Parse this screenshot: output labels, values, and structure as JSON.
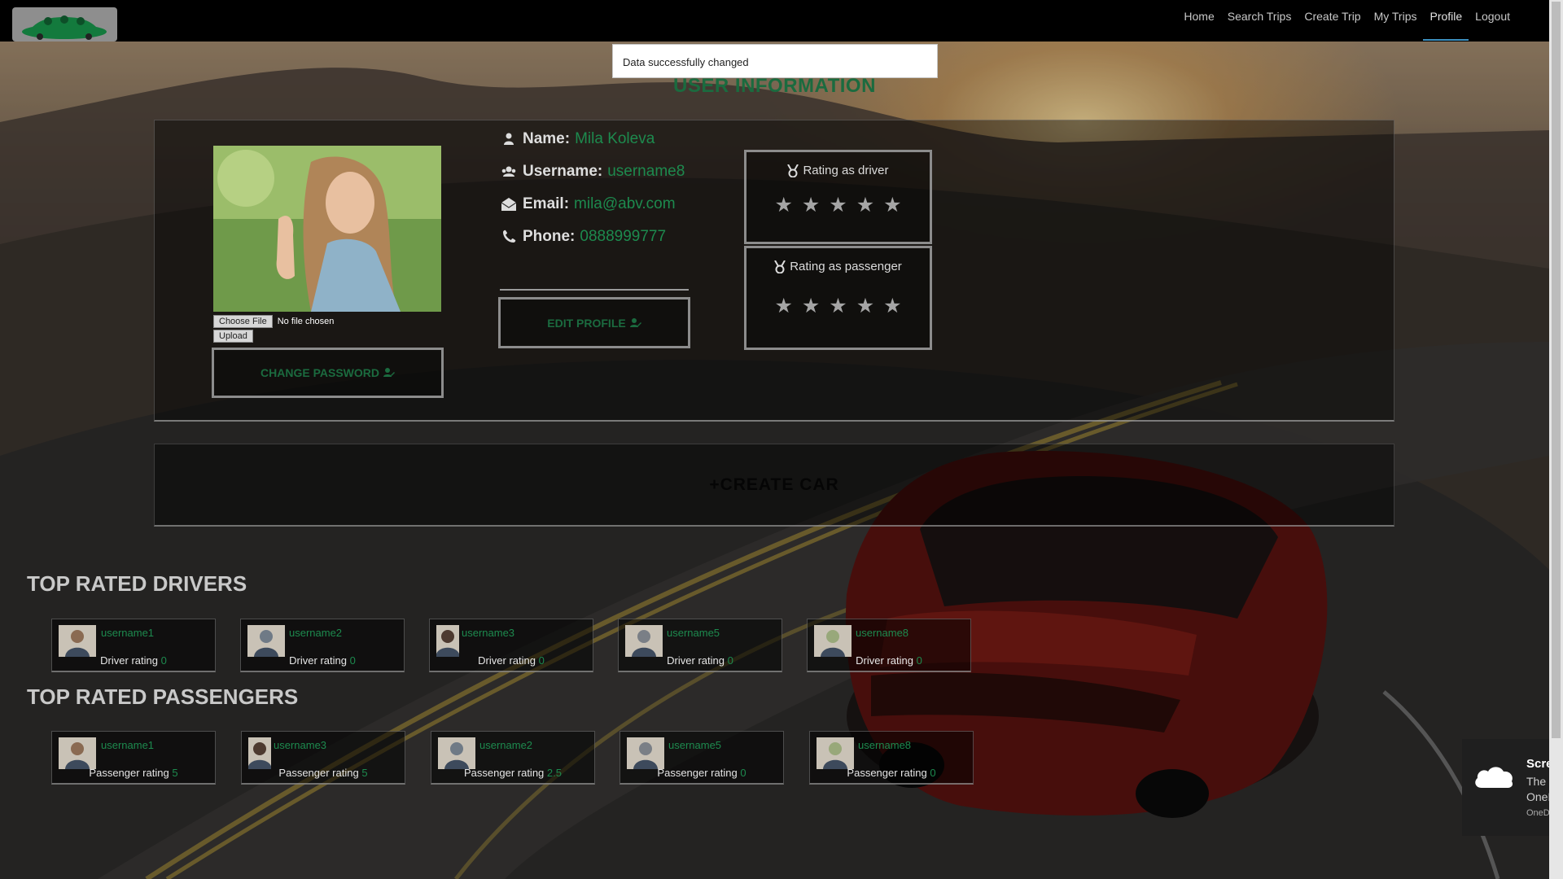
{
  "nav": {
    "items": [
      {
        "label": "Home"
      },
      {
        "label": "Search Trips"
      },
      {
        "label": "Create Trip"
      },
      {
        "label": "My Trips"
      },
      {
        "label": "Profile",
        "active": true
      },
      {
        "label": "Logout"
      }
    ]
  },
  "alert": {
    "text": "Data successfully changed"
  },
  "page_title": "USER INFORMATION",
  "profile": {
    "file_button": "Choose File",
    "file_status": "No file chosen",
    "upload_button": "Upload",
    "change_password": "CHANGE PASSWORD",
    "edit_profile": "EDIT PROFILE",
    "name_label": "Name:",
    "name": "Mila Koleva",
    "username_label": "Username:",
    "username": "username8",
    "email_label": "Email:",
    "email": "mila@abv.com",
    "phone_label": "Phone:",
    "phone": "0888999777",
    "driver_rating_label": "Rating as driver",
    "passenger_rating_label": "Rating as passenger",
    "driver_stars_filled": 0,
    "passenger_stars_filled": 0,
    "stars_total": 5
  },
  "create_car": "+CREATE CAR",
  "top_drivers": {
    "title": "TOP RATED DRIVERS",
    "rating_label": "Driver rating",
    "items": [
      {
        "username": "username1",
        "rating": "0"
      },
      {
        "username": "username2",
        "rating": "0"
      },
      {
        "username": "username3",
        "rating": "0"
      },
      {
        "username": "username5",
        "rating": "0"
      },
      {
        "username": "username8",
        "rating": "0"
      }
    ]
  },
  "top_passengers": {
    "title": "TOP RATED PASSENGERS",
    "rating_label": "Passenger rating",
    "items": [
      {
        "username": "username1",
        "rating": "5"
      },
      {
        "username": "username3",
        "rating": "5"
      },
      {
        "username": "username2",
        "rating": "2.5"
      },
      {
        "username": "username5",
        "rating": "0"
      },
      {
        "username": "username8",
        "rating": "0"
      }
    ]
  },
  "notification": {
    "title": "Screen",
    "line1": "The sc",
    "line2": "OneDr",
    "source": "OneDriv"
  },
  "colors": {
    "accent_green": "#1d8a4e",
    "title_green": "#1b6b3f",
    "nav_active_underline": "#3c8fbf"
  }
}
